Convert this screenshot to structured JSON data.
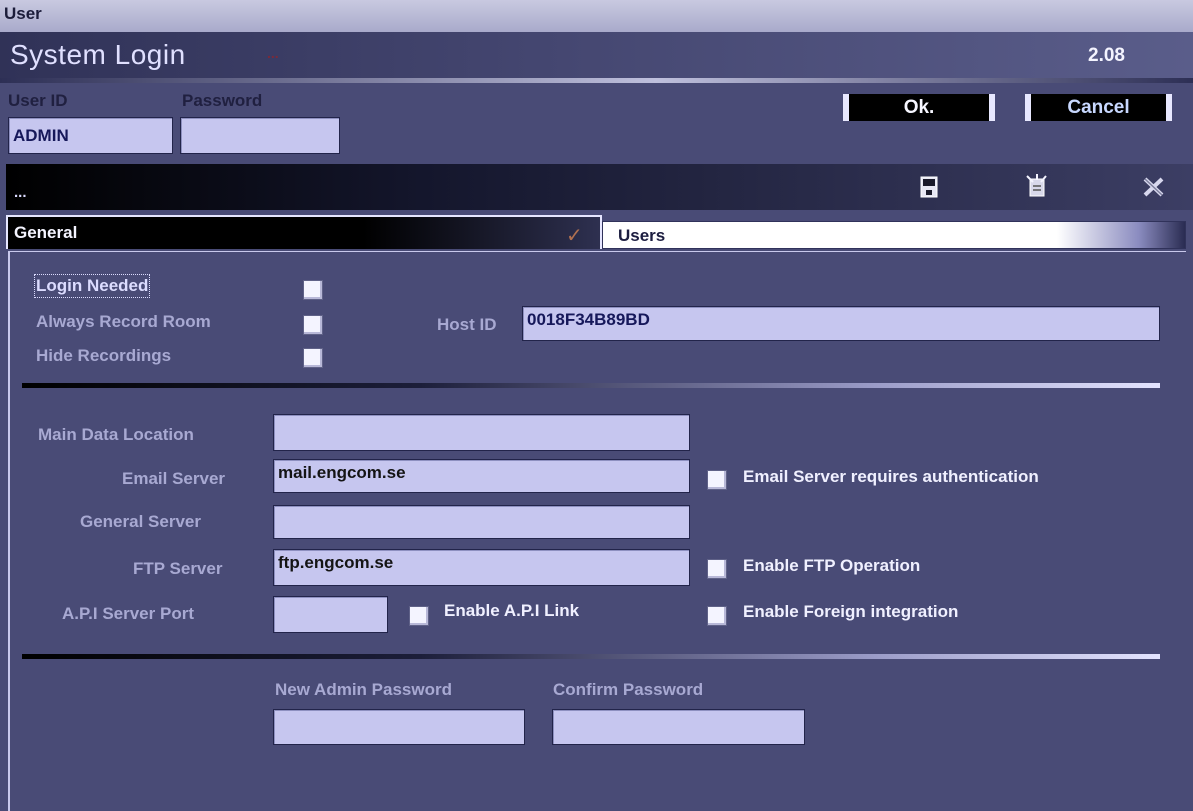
{
  "window": {
    "title": "User"
  },
  "header": {
    "title": "System Login",
    "dots": "...",
    "version": "2.08"
  },
  "login": {
    "user_id_label": "User ID",
    "password_label": "Password",
    "user_id_value": "ADMIN",
    "password_value": "",
    "ok_label": "Ok.",
    "cancel_label": "Cancel"
  },
  "toolbar": {
    "status_text": "...",
    "icons": [
      "save-icon",
      "new-document-icon",
      "close-icon"
    ]
  },
  "tabs": [
    {
      "label": "General",
      "selected": true,
      "check": "✓"
    },
    {
      "label": "Users",
      "selected": false
    }
  ],
  "general": {
    "login_needed_label": "Login Needed",
    "always_record_label": "Always Record Room",
    "hide_recordings_label": "Hide Recordings",
    "login_needed": false,
    "always_record": false,
    "hide_recordings": false,
    "host_id_label": "Host ID",
    "host_id_value": "0018F34B89BD",
    "main_data_location_label": "Main Data Location",
    "main_data_location_value": "",
    "email_server_label": "Email Server",
    "email_server_value": "mail.engcom.se",
    "email_auth_label": "Email Server requires authentication",
    "general_server_label": "General Server",
    "general_server_value": "",
    "ftp_server_label": "FTP Server",
    "ftp_server_value": "ftp.engcom.se",
    "enable_ftp_label": "Enable FTP Operation",
    "api_port_label": "A.P.I Server Port",
    "api_port_value": "",
    "enable_api_label": "Enable A.P.I Link",
    "enable_foreign_label": "Enable Foreign integration",
    "new_admin_password_label": "New Admin Password",
    "confirm_password_label": "Confirm Password",
    "new_admin_password_value": "",
    "confirm_password_value": ""
  },
  "colors": {
    "background": "#494b76",
    "field": "#c6c6ef",
    "field_text": "#16185a"
  }
}
